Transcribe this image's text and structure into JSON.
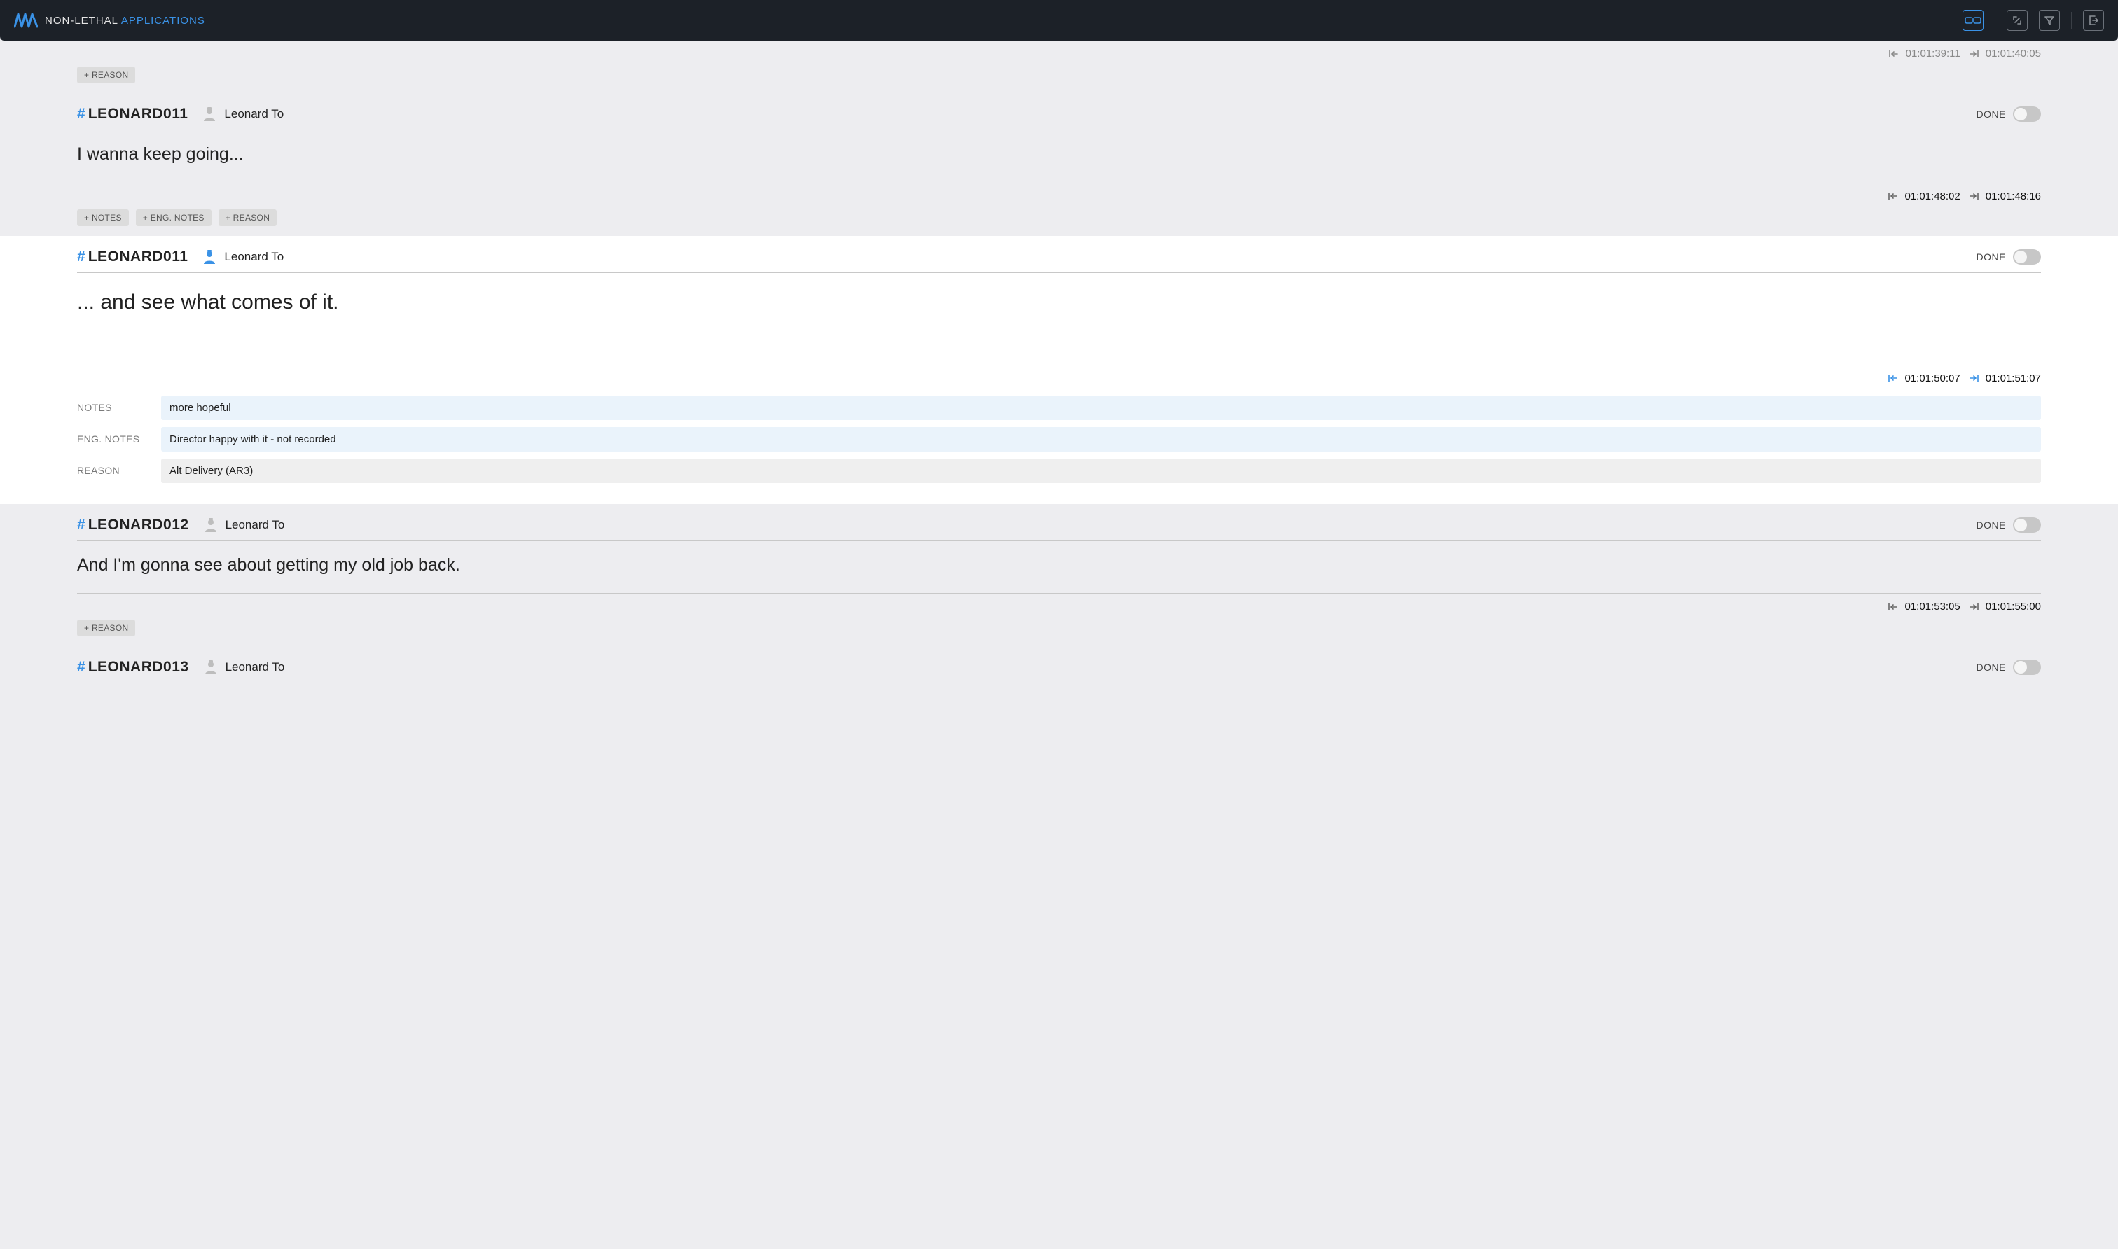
{
  "brand": {
    "part1": "NON-LETHAL",
    "part2": "APPLICATIONS"
  },
  "labels": {
    "done": "DONE",
    "add_notes": "+ NOTES",
    "add_eng_notes": "+ ENG. NOTES",
    "add_reason": "+ REASON",
    "notes": "NOTES",
    "eng_notes": "ENG. NOTES",
    "reason": "REASON"
  },
  "records": [
    {
      "cutoff_top": true,
      "tc_in": "01:01:39:11",
      "tc_out": "01:01:40:05",
      "tc_partial": true,
      "tags": [
        "add_reason"
      ]
    },
    {
      "id": "LEONARD011",
      "character": "Leonard To",
      "person_icon": "grey",
      "dialogue": "I wanna keep going...",
      "tc_in": "01:01:48:02",
      "tc_out": "01:01:48:16",
      "tags": [
        "add_notes",
        "add_eng_notes",
        "add_reason"
      ]
    },
    {
      "alt": true,
      "id": "LEONARD011",
      "character": "Leonard To",
      "person_icon": "blue",
      "dialogue": "... and see what comes of it.",
      "dialogue_large": true,
      "tc_in": "01:01:50:07",
      "tc_out": "01:01:51:07",
      "tc_alt": true,
      "meta": {
        "notes": "more hopeful",
        "eng_notes": "Director happy with it - not recorded",
        "reason": "Alt Delivery (AR3)"
      }
    },
    {
      "id": "LEONARD012",
      "character": "Leonard To",
      "person_icon": "grey",
      "dialogue": "And I'm gonna see about getting my old job back.",
      "tc_in": "01:01:53:05",
      "tc_out": "01:01:55:00",
      "tags": [
        "add_reason"
      ]
    },
    {
      "id": "LEONARD013",
      "character": "Leonard To",
      "person_icon": "grey",
      "cutoff_bottom": true
    }
  ]
}
